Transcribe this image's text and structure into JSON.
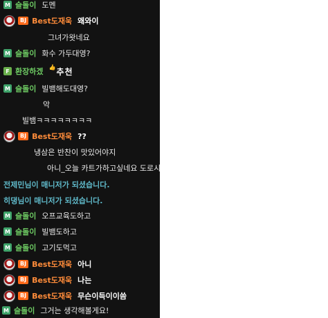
{
  "chat": {
    "messages": [
      {
        "type": "user",
        "badge": "M",
        "nick": "슬돌이",
        "text": "도멘"
      },
      {
        "type": "bj",
        "badge": "BJ",
        "nick": "Best도재욱",
        "text": "왜와이"
      },
      {
        "type": "cont",
        "text": "그녀가왓네요"
      },
      {
        "type": "user",
        "badge": "M",
        "nick": "슬돌이",
        "text": "화수 가두대영?"
      },
      {
        "type": "user",
        "badge": "F",
        "nick": "환장하겠",
        "text": "추천"
      },
      {
        "type": "user",
        "badge": "M",
        "nick": "슬돌이",
        "text": "빌뱀해도대영?"
      },
      {
        "type": "cont",
        "text": "악"
      },
      {
        "type": "cont",
        "text": "빌뱀ㅋㅋㅋㅋㅋㅋㅋㅋ"
      },
      {
        "type": "bj",
        "badge": "BJ",
        "nick": "Best도재욱",
        "text": "??"
      },
      {
        "type": "cont",
        "text": "냉삼은 반찬이 맛있어야지"
      },
      {
        "type": "cont",
        "text": "아니_오늘 카트가하고싶네요 도로시"
      },
      {
        "type": "system",
        "text": "전제민님이 매니저가 되셨습니다."
      },
      {
        "type": "system",
        "text": "히댕님이 매니저가 되셨습니다."
      },
      {
        "type": "user",
        "badge": "M",
        "nick": "슬돌이",
        "text": "오프교육도하고"
      },
      {
        "type": "user",
        "badge": "M",
        "nick": "슬돌이",
        "text": "빌뱀도하고"
      },
      {
        "type": "user",
        "badge": "M",
        "nick": "슬돌이",
        "text": "고기도먹고"
      },
      {
        "type": "bj",
        "badge": "BJ",
        "nick": "Best도재욱",
        "text": "아니"
      },
      {
        "type": "bj",
        "badge": "BJ",
        "nick": "Best도재욱",
        "text": "나는"
      },
      {
        "type": "bj",
        "badge": "BJ",
        "nick": "Best도재욱",
        "text": "무슨이득이이씀"
      },
      {
        "type": "user",
        "badge": "M",
        "nick": "슬돌이",
        "text": "그거는 생각해볼게요!"
      }
    ]
  }
}
